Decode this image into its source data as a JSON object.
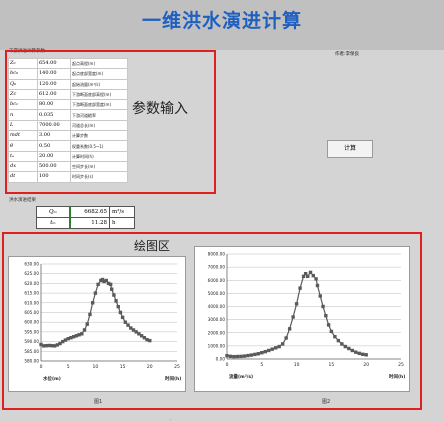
{
  "app": {
    "title": "一维洪水演进计算"
  },
  "params_section": {
    "label": "下游洪进计算参数",
    "author": "作者:李保良",
    "title": "参数输入",
    "rows": [
      {
        "sym": "Z₀",
        "val": "654.00",
        "desc": "起点高程(m)"
      },
      {
        "sym": "bc₀",
        "val": "140.00",
        "desc": "起点底部宽度(m)"
      },
      {
        "sym": "Q₀",
        "val": "120.00",
        "desc": "起始流量(m³/s)"
      },
      {
        "sym": "Zc",
        "val": "612.00",
        "desc": "下游断面底部高程(m)"
      },
      {
        "sym": "bc₁",
        "val": "80.00",
        "desc": "下游断面底部宽度(m)"
      },
      {
        "sym": "n",
        "val": "0.035",
        "desc": "下游河道糙率"
      },
      {
        "sym": "L",
        "val": "7000.00",
        "desc": "河道总长(m)"
      },
      {
        "sym": "mdt",
        "val": "3.00",
        "desc": "计算步数"
      },
      {
        "sym": "θ",
        "val": "0.50",
        "desc": "权重系数(0.5~1)"
      },
      {
        "sym": "tₑ",
        "val": "20.00",
        "desc": "计算时间(h)"
      },
      {
        "sym": "dx",
        "val": "500.00",
        "desc": "空间步长(m)"
      },
      {
        "sym": "dt",
        "val": "100",
        "desc": "时间步长(s)"
      }
    ]
  },
  "calc_button": {
    "label": "计算"
  },
  "results": {
    "label": "洪水演进结果",
    "rows": [
      {
        "sym": "Qₘ",
        "val": "6682.65",
        "unit": "m³/s"
      },
      {
        "sym": "tₘ",
        "val": "11.28",
        "unit": "h"
      }
    ]
  },
  "plot_area": {
    "title": "绘图区"
  },
  "bottom_glyph": "·",
  "chart_data": [
    {
      "type": "scatter",
      "caption": "图1",
      "xlabel": "时间(h)",
      "ylabel": "水位(m)",
      "xlim": [
        0,
        25
      ],
      "ylim": [
        580,
        630
      ],
      "xticks": [
        0,
        5,
        10,
        15,
        20,
        25
      ],
      "yticks": [
        580,
        585,
        590,
        595,
        600,
        605,
        610,
        615,
        620,
        625,
        630
      ],
      "ytick_labels": [
        "580.00",
        "585.00",
        "590.00",
        "595.00",
        "600.00",
        "605.00",
        "610.00",
        "615.00",
        "620.00",
        "625.00",
        "630.00"
      ],
      "marker_color": "#5a5a5a",
      "x": [
        0,
        0.5,
        1,
        1.5,
        2,
        2.5,
        3,
        3.5,
        4,
        4.5,
        5,
        5.5,
        6,
        6.5,
        7,
        7.5,
        8,
        8.5,
        9,
        9.5,
        10,
        10.5,
        11,
        11.3,
        11.6,
        12,
        12.4,
        12.8,
        13,
        13.4,
        13.8,
        14.2,
        14.6,
        15,
        15.5,
        16,
        16.5,
        17,
        17.5,
        18,
        18.5,
        19,
        19.5,
        20
      ],
      "y": [
        588.5,
        587.8,
        587.9,
        588.0,
        587.9,
        587.8,
        588.3,
        589.0,
        590.0,
        590.8,
        591.5,
        592.0,
        592.5,
        593.0,
        593.5,
        594.0,
        596.0,
        599.0,
        604.0,
        610.0,
        615.0,
        619.5,
        621.5,
        622.0,
        621.0,
        621.5,
        620.0,
        619.5,
        617.0,
        614.0,
        611.0,
        608.0,
        605.0,
        602.5,
        600.0,
        598.5,
        597.0,
        596.0,
        595.0,
        594.0,
        593.0,
        592.0,
        591.0,
        590.5
      ]
    },
    {
      "type": "scatter",
      "caption": "图2",
      "xlabel": "时间(h)",
      "ylabel": "流量(m³/s)",
      "xlim": [
        0,
        25
      ],
      "ylim": [
        0,
        8000
      ],
      "xticks": [
        0,
        5,
        10,
        15,
        20,
        25
      ],
      "yticks": [
        0,
        1000,
        2000,
        3000,
        4000,
        5000,
        6000,
        7000,
        8000
      ],
      "ytick_labels": [
        "0.00",
        "1000.00",
        "2000.00",
        "3000.00",
        "4000.00",
        "5000.00",
        "6000.00",
        "7000.00",
        "8000.00"
      ],
      "marker_color": "#5a5a5a",
      "x": [
        0,
        0.5,
        1,
        1.5,
        2,
        2.5,
        3,
        3.5,
        4,
        4.5,
        5,
        5.5,
        6,
        6.5,
        7,
        7.5,
        8,
        8.5,
        9,
        9.5,
        10,
        10.5,
        11,
        11.3,
        11.6,
        12,
        12.4,
        12.8,
        13,
        13.4,
        13.8,
        14.2,
        14.6,
        15,
        15.5,
        16,
        16.5,
        17,
        17.5,
        18,
        18.5,
        19,
        19.5,
        20
      ],
      "y": [
        250,
        200,
        180,
        190,
        200,
        220,
        260,
        300,
        350,
        400,
        480,
        560,
        650,
        750,
        850,
        950,
        1150,
        1600,
        2300,
        3200,
        4200,
        5400,
        6300,
        6500,
        6300,
        6600,
        6350,
        6100,
        5600,
        4800,
        4000,
        3300,
        2600,
        2100,
        1700,
        1400,
        1150,
        950,
        800,
        650,
        520,
        430,
        360,
        320
      ]
    }
  ]
}
